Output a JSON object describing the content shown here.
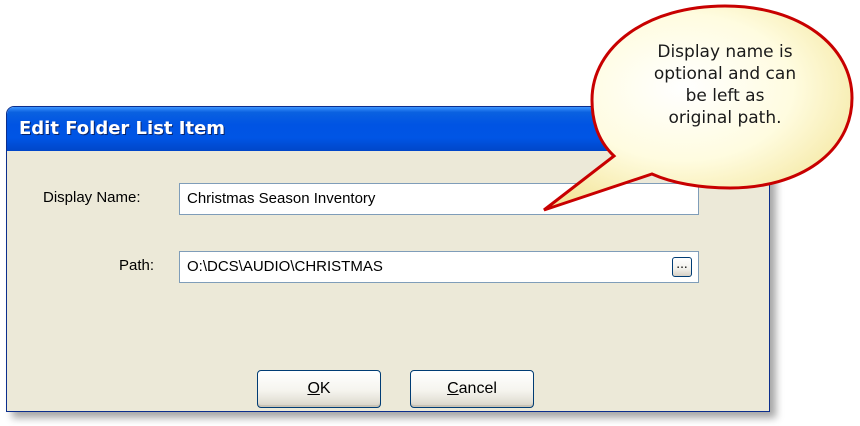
{
  "dialog": {
    "title": "Edit Folder List Item",
    "display_name_label": "Display Name:",
    "display_name_value": "Christmas Season Inventory",
    "path_label": "Path:",
    "path_value": "O:\\DCS\\AUDIO\\CHRISTMAS",
    "browse_label": "...",
    "ok_label": "OK",
    "ok_mnemonic": "O",
    "ok_rest": "K",
    "cancel_mnemonic": "C",
    "cancel_rest": "ancel"
  },
  "callout": {
    "lines": [
      "Display name is",
      "optional and can",
      "be left as",
      "original path."
    ]
  },
  "colors": {
    "title_bar": "#0054E3",
    "dialog_bg": "#ECE9D8",
    "callout_fill": "#FFF9C4",
    "callout_border": "#C80000"
  }
}
